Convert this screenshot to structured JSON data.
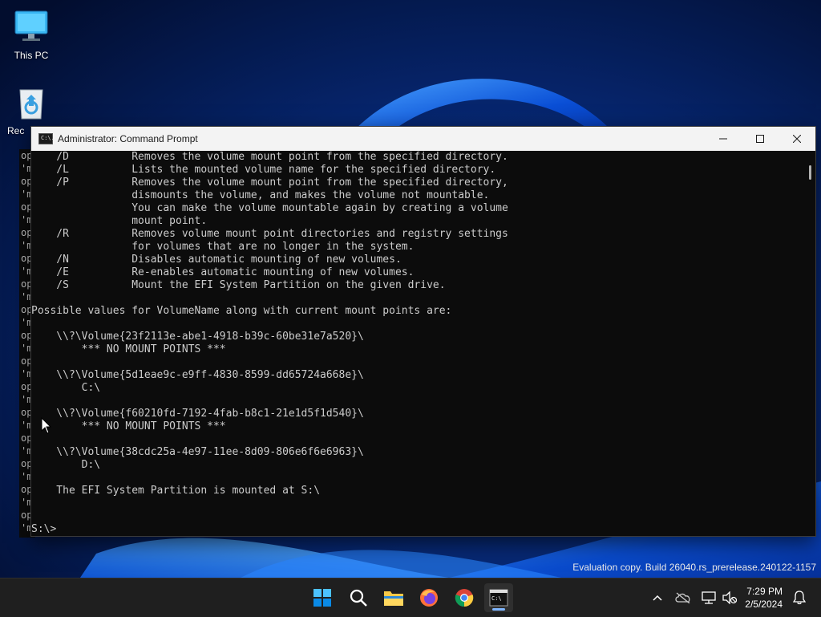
{
  "desktop": {
    "icons": [
      {
        "label": "This PC",
        "icon": "computer-icon"
      },
      {
        "label": "Rec",
        "icon": "recycle-bin-icon"
      }
    ]
  },
  "background_console": {
    "lines": [
      "op",
      "'m",
      "op",
      "'m",
      "op",
      "'m",
      "op",
      "'m",
      "op",
      "'m",
      "op",
      "'m",
      "op",
      "'m",
      "op",
      "'m",
      "op",
      "'m",
      "op",
      "'m",
      "op",
      "'m",
      "op",
      "'m",
      "op",
      "'m",
      "op",
      "'m",
      "op",
      "'m",
      "op"
    ]
  },
  "window": {
    "title": "Administrator: Command Prompt",
    "icon": "cmd-icon",
    "icon_text": "C:\\.",
    "controls": [
      "minimize-icon",
      "maximize-icon",
      "close-icon"
    ],
    "console_text": "    /D          Removes the volume mount point from the specified directory.\n    /L          Lists the mounted volume name for the specified directory.\n    /P          Removes the volume mount point from the specified directory,\n                dismounts the volume, and makes the volume not mountable.\n                You can make the volume mountable again by creating a volume\n                mount point.\n    /R          Removes volume mount point directories and registry settings\n                for volumes that are no longer in the system.\n    /N          Disables automatic mounting of new volumes.\n    /E          Re-enables automatic mounting of new volumes.\n    /S          Mount the EFI System Partition on the given drive.\n\nPossible values for VolumeName along with current mount points are:\n\n    \\\\?\\Volume{23f2113e-abe1-4918-b39c-60be31e7a520}\\\n        *** NO MOUNT POINTS ***\n\n    \\\\?\\Volume{5d1eae9c-e9ff-4830-8599-dd65724a668e}\\\n        C:\\\n\n    \\\\?\\Volume{f60210fd-7192-4fab-b8c1-21e1d5f1d540}\\\n        *** NO MOUNT POINTS ***\n\n    \\\\?\\Volume{38cdc25a-4e97-11ee-8d09-806e6f6e6963}\\\n        D:\\\n\n    The EFI System Partition is mounted at S:\\\n\n\nS:\\>"
  },
  "watermark": "Evaluation copy. Build 26040.rs_prerelease.240122-1157",
  "taskbar": {
    "items": [
      {
        "name": "start-button",
        "icon": "windows-logo-icon"
      },
      {
        "name": "search-button",
        "icon": "search-icon"
      },
      {
        "name": "file-explorer-button",
        "icon": "folder-icon"
      },
      {
        "name": "firefox-button",
        "icon": "firefox-icon"
      },
      {
        "name": "chrome-button",
        "icon": "chrome-icon"
      },
      {
        "name": "terminal-button",
        "icon": "terminal-icon",
        "active": true
      }
    ],
    "tray": {
      "icons": [
        "chevron-up-icon",
        "cloud-offline-icon",
        "network-icon",
        "volume-muted-icon"
      ],
      "time": "7:29 PM",
      "date": "2/5/2024",
      "notification_icon": "bell-icon"
    }
  },
  "colors": {
    "console_bg": "#0c0c0c",
    "console_fg": "#cccccc",
    "titlebar_bg": "#f3f3f3",
    "taskbar_bg": "#1f1f1f",
    "accent": "#7fb6ff"
  }
}
